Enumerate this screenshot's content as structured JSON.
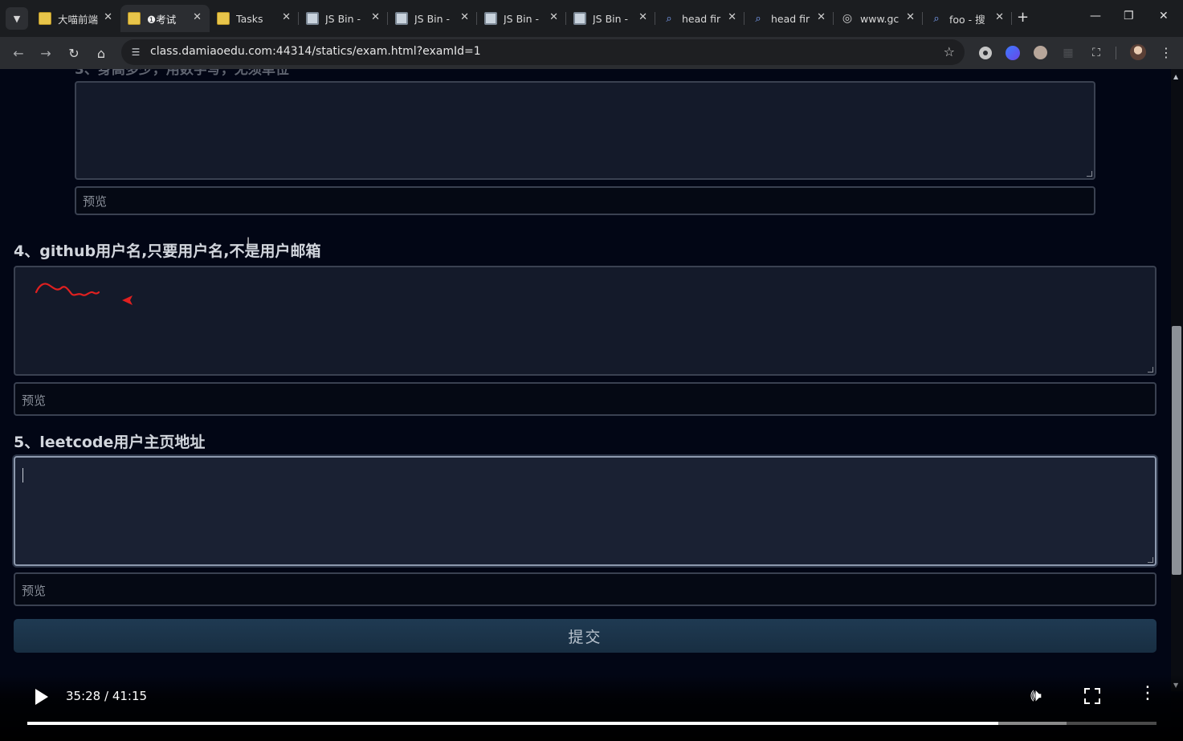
{
  "tabs": [
    {
      "title": "大喵前端",
      "icon": "note-icon",
      "active": false
    },
    {
      "title": "❶考试",
      "icon": "note-icon",
      "active": true
    },
    {
      "title": "Tasks",
      "icon": "note-icon",
      "active": false
    },
    {
      "title": "JS Bin -",
      "icon": "jsbin-icon",
      "active": false
    },
    {
      "title": "JS Bin -",
      "icon": "jsbin-icon",
      "active": false
    },
    {
      "title": "JS Bin -",
      "icon": "jsbin-icon",
      "active": false
    },
    {
      "title": "JS Bin -",
      "icon": "jsbin-icon",
      "active": false
    },
    {
      "title": "head fir",
      "icon": "search-icon",
      "active": false
    },
    {
      "title": "head fir",
      "icon": "search-icon",
      "active": false
    },
    {
      "title": "www.gc",
      "icon": "globe-icon",
      "active": false
    },
    {
      "title": "foo - 搜",
      "icon": "search-icon",
      "active": false
    }
  ],
  "browser": {
    "url": "class.damiaoedu.com:44314/statics/exam.html?examId=1"
  },
  "exam": {
    "q3": {
      "title_partial": "3、身高多少，用数字写，无须单位",
      "preview_placeholder": "预览"
    },
    "q4": {
      "title": "4、github用户名,只要用户名,不是用户邮箱",
      "preview_placeholder": "预览"
    },
    "q5": {
      "title": "5、leetcode用户主页地址",
      "preview_placeholder": "预览"
    },
    "submit_label": "提交"
  },
  "video": {
    "time": "35:28 / 41:15",
    "progress": 0.86,
    "buffered": 0.92
  },
  "colors": {
    "page_bg": "#020615",
    "annotation_red": "#e02020",
    "submit_bg": "#1f3a52"
  }
}
